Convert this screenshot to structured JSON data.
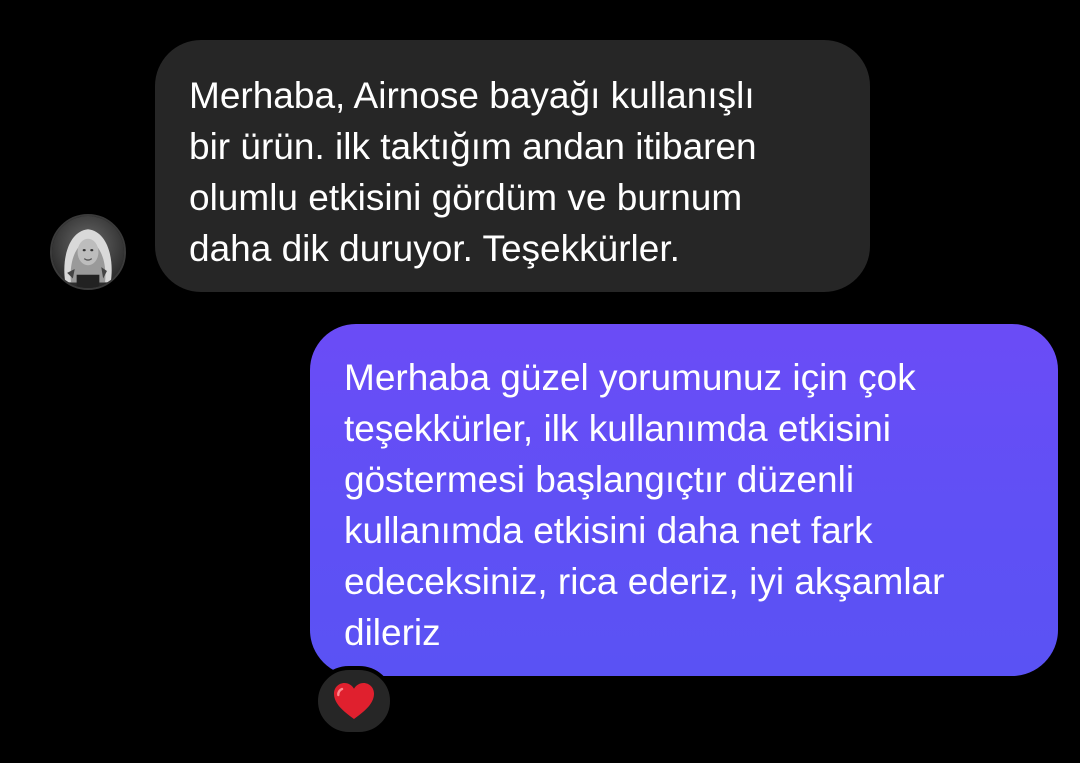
{
  "conversation": {
    "incoming_message": {
      "text": "Merhaba, Airnose bayağı kullanışlı\nbir ürün. ilk taktığım andan itibaren\nolumlu etkisini gördüm ve burnum\ndaha dik duruyor. Teşekkürler.",
      "sender_avatar": "user-avatar-icon",
      "bubble_color": "#262626"
    },
    "outgoing_message": {
      "text": "Merhaba güzel yorumunuz için çok\nteşekkürler, ilk kullanımda etkisini\ngöstermesi başlangıçtır düzenli\nkullanımda etkisini daha net fark\nedeceksiniz, rica ederiz, iyi akşamlar\ndileriz",
      "bubble_color": "#5f50f5",
      "reaction": "heart-icon",
      "reaction_color": "#e0202e"
    },
    "background_color": "#000000"
  }
}
